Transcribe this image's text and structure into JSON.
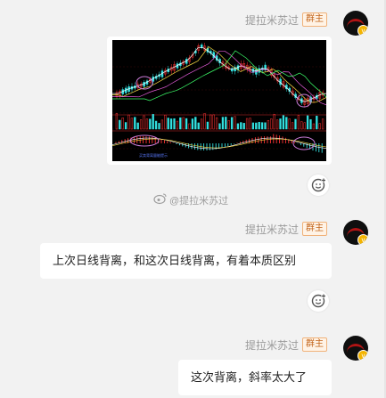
{
  "messages": [
    {
      "author": "提拉米苏过",
      "badge": "群主",
      "type": "image"
    },
    {
      "author": "提拉米苏过",
      "badge": "群主",
      "type": "text",
      "text": "上次日线背离，和这次日线背离，有着本质区别"
    },
    {
      "author": "提拉米苏过",
      "badge": "群主",
      "type": "text",
      "text": "这次背离，斜率太大了"
    }
  ],
  "watermark": "@提拉米苏过",
  "chart_caption": "买卖背离量能提示",
  "icons": {
    "avatar": "avatar-icon",
    "verified": "verified-badge-icon",
    "reaction": "add-reaction-icon",
    "weibo": "weibo-icon"
  },
  "colors": {
    "page_bg": "#f2f2f2",
    "bubble_bg": "#ffffff",
    "badge_text": "#c2641a",
    "chart_bg": "#000000",
    "chart_up": "#ff3333",
    "chart_down": "#33e0e0",
    "highlight_circle": "#c97ad6"
  }
}
